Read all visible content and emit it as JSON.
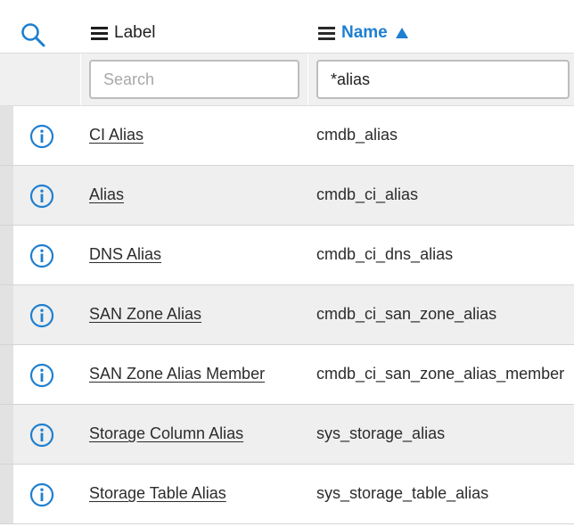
{
  "header": {
    "label_col": "Label",
    "name_col": "Name",
    "search_icon": "search-icon",
    "sort": "ascending"
  },
  "filters": {
    "label_placeholder": "Search",
    "label_value": "",
    "name_value": "*alias"
  },
  "colors": {
    "accent": "#1f7fd0",
    "alt_row": "#efefef"
  },
  "rows": [
    {
      "label": "CI Alias",
      "name": "cmdb_alias"
    },
    {
      "label": "Alias",
      "name": "cmdb_ci_alias"
    },
    {
      "label": "DNS Alias",
      "name": "cmdb_ci_dns_alias"
    },
    {
      "label": "SAN Zone Alias",
      "name": "cmdb_ci_san_zone_alias"
    },
    {
      "label": "SAN Zone Alias Member",
      "name": "cmdb_ci_san_zone_alias_member"
    },
    {
      "label": "Storage Column Alias",
      "name": "sys_storage_alias"
    },
    {
      "label": "Storage Table Alias",
      "name": "sys_storage_table_alias"
    }
  ]
}
